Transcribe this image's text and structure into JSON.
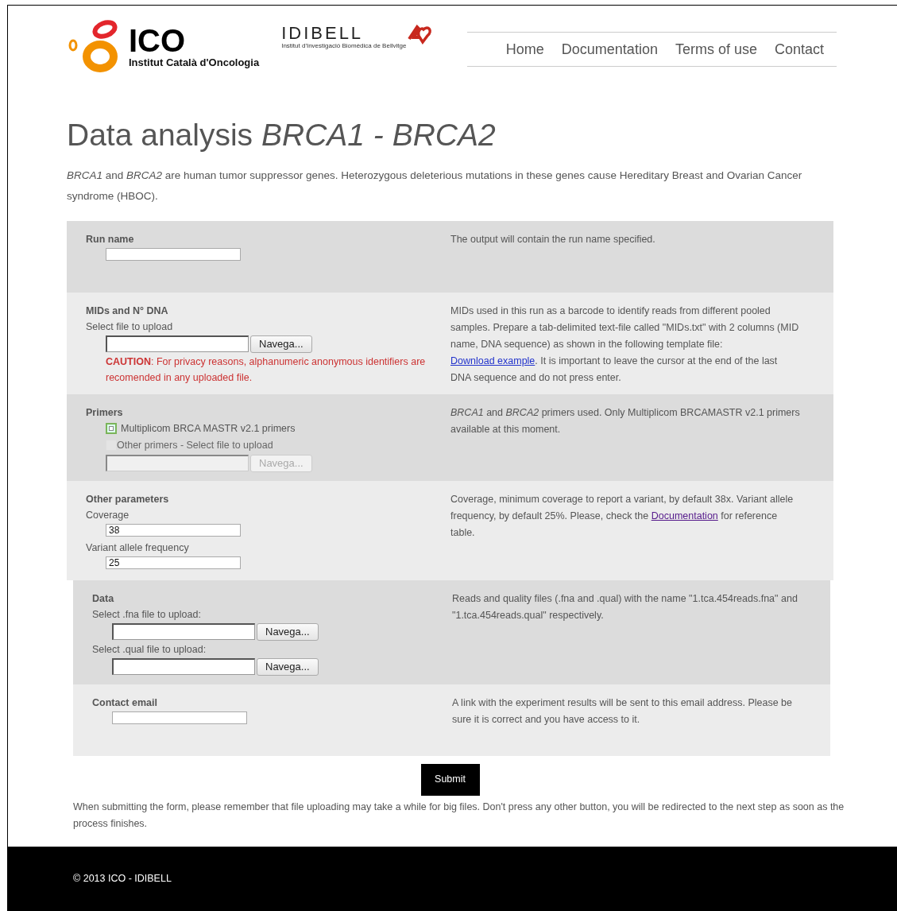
{
  "header": {
    "ico_logo": {
      "wordmark": "ICO",
      "subtitle": "Institut Català d'Oncologia"
    },
    "idibell_logo": {
      "wordmark": "IDIBELL",
      "subtitle": "Institut d'Investigació Biomèdica de Bellvitge"
    },
    "nav": [
      {
        "label": "Home"
      },
      {
        "label": "Documentation"
      },
      {
        "label": "Terms of use"
      },
      {
        "label": "Contact"
      }
    ]
  },
  "title": "Data analysis *BRCA1 - BRCA2*",
  "intro": "*BRCA1* and *BRCA2* are human tumor suppressor genes. Heterozygous deleterious mutations in these genes cause Hereditary Breast and Ovarian Cancer syndrome (HBOC).",
  "sections": [
    {
      "title": "Run name",
      "indented": false,
      "fields": [
        {
          "kind": "text"
        }
      ],
      "help": [
        {
          "text": "The output will contain the run name specified."
        }
      ]
    },
    {
      "title": "MIDs and N° DNA",
      "indented": false,
      "fields": [
        {
          "kind": "label",
          "text": "Select file to upload"
        },
        {
          "kind": "file",
          "button": "Navega...",
          "disabled": false
        },
        {
          "kind": "caution",
          "text": "**CAUTION**: For privacy reasons, alphanumeric anonymous identifiers are recomended in any uploaded file."
        }
      ],
      "help": [
        {
          "text": "MIDs used in this run as a barcode to identify reads from different pooled samples. Prepare a tab-delimited text-file called \"MIDs.txt\" with 2 columns (MID name, DNA sequence) as shown in the following template file: "
        },
        {
          "link": "Download example",
          "visited": false
        },
        {
          "text": ". It is important to leave the cursor at the end of the last DNA sequence and do not press enter."
        }
      ]
    },
    {
      "title": "Primers",
      "indented": false,
      "fields": [
        {
          "kind": "checkbox",
          "label": "Multiplicom BRCA MASTR v2.1 primers",
          "checked": true,
          "disabled": false
        },
        {
          "kind": "checkbox",
          "label": "Other primers - Select file to upload",
          "checked": false,
          "disabled": true
        },
        {
          "kind": "file",
          "button": "Navega...",
          "disabled": true
        }
      ],
      "help": [
        {
          "text": "*BRCA1* and *BRCA2* primers used. Only Multiplicom BRCAMASTR v2.1 primers available at this moment."
        }
      ]
    },
    {
      "title": "Other parameters",
      "indented": false,
      "fields": [
        {
          "kind": "label",
          "text": "Coverage"
        },
        {
          "kind": "text",
          "value": "38"
        },
        {
          "kind": "label",
          "text": "Variant allele frequency"
        },
        {
          "kind": "text",
          "value": "25"
        }
      ],
      "help": [
        {
          "text": "Coverage, minimum coverage to report a variant, by default 38x. Variant allele frequency, by default 25%. Please, check the "
        },
        {
          "link": "Documentation",
          "visited": true
        },
        {
          "text": " for reference table."
        }
      ]
    },
    {
      "title": "Data",
      "indented": true,
      "fields": [
        {
          "kind": "label",
          "text": "Select .fna file to upload:"
        },
        {
          "kind": "file",
          "button": "Navega...",
          "disabled": false
        },
        {
          "kind": "label",
          "text": "Select .qual file to upload:"
        },
        {
          "kind": "file",
          "button": "Navega...",
          "disabled": false
        }
      ],
      "help": [
        {
          "text": "Reads and quality files (.fna and .qual) with the name \"1.tca.454reads.fna\" and \"1.tca.454reads.qual\" respectively."
        }
      ]
    },
    {
      "title": "Contact email",
      "indented": true,
      "fields": [
        {
          "kind": "text"
        }
      ],
      "help": [
        {
          "text": "A link with the experiment results will be sent to this email address. Please be sure it is correct and you have access to it."
        }
      ]
    }
  ],
  "submit": "Submit",
  "note": "When submitting the form, please remember that file uploading may take a while for big files. Don't press any other button, you will be redirected to the next step as soon as the process finishes.",
  "footer": "© 2013 ICO - IDIBELL"
}
